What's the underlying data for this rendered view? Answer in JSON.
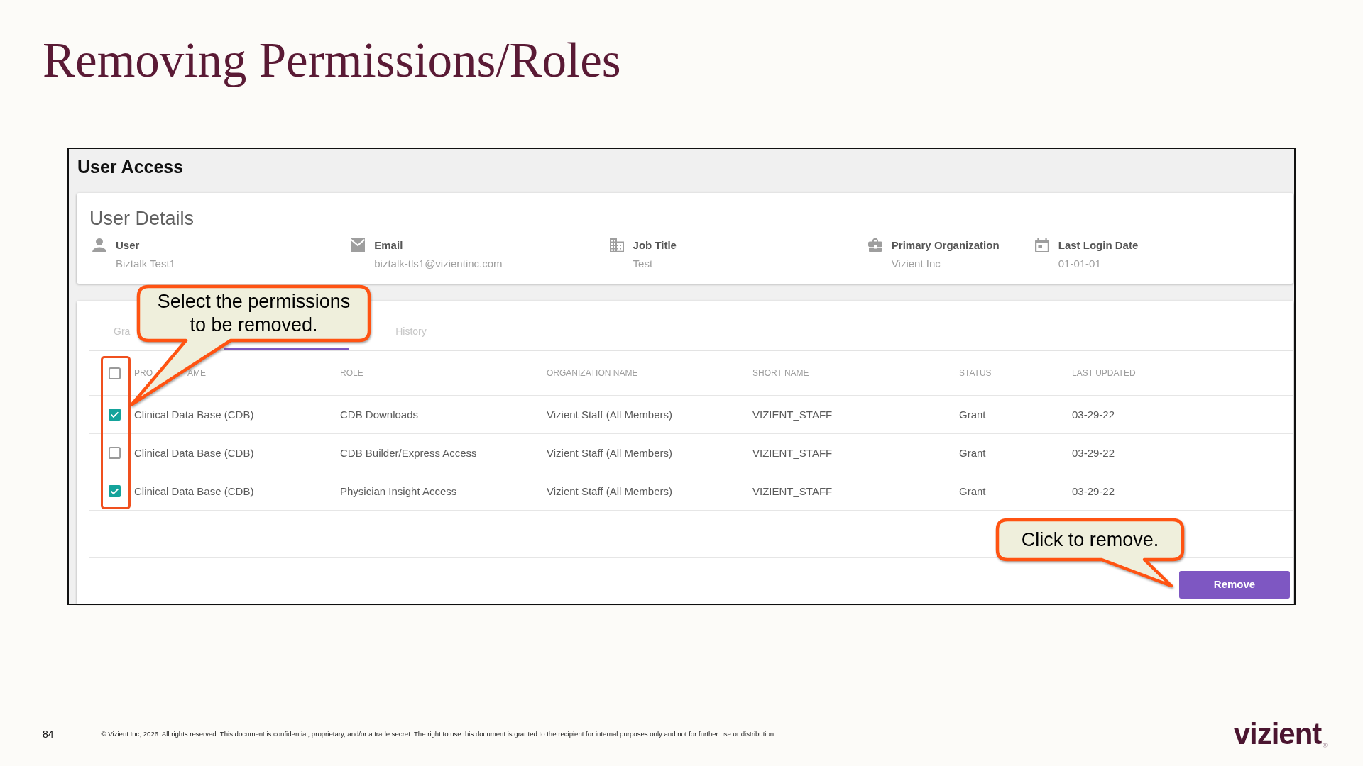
{
  "slide": {
    "title": "Removing Permissions/Roles"
  },
  "app": {
    "title": "User Access",
    "user_details": {
      "title": "User Details",
      "fields": [
        {
          "kind": "user",
          "label": "User",
          "value": "Biztalk Test1"
        },
        {
          "kind": "email",
          "label": "Email",
          "value": "biztalk-tls1@vizientinc.com"
        },
        {
          "kind": "job",
          "label": "Job Title",
          "value": "Test"
        },
        {
          "kind": "organization",
          "label": "Primary Organization",
          "value": "Vizient Inc"
        },
        {
          "kind": "date",
          "label": "Last Login Date",
          "value": "01-01-01"
        }
      ]
    },
    "tabs": [
      {
        "label": "Gra",
        "selected": false
      },
      {
        "selected": true
      },
      {
        "label": "History",
        "selected": false
      }
    ],
    "table": {
      "select_all": {
        "checked": false
      },
      "columns": [
        {
          "label_parts": [
            "PRO",
            "AME"
          ]
        },
        {
          "label": "ROLE"
        },
        {
          "label": "ORGANIZATION NAME"
        },
        {
          "label": "SHORT NAME"
        },
        {
          "label": "STATUS"
        },
        {
          "label": "LAST UPDATED"
        }
      ],
      "rows": [
        {
          "checked": true,
          "cells": [
            "Clinical Data Base (CDB)",
            "CDB Downloads",
            "Vizient Staff (All Members)",
            "VIZIENT_STAFF",
            "Grant",
            "03-29-22"
          ]
        },
        {
          "checked": false,
          "cells": [
            "Clinical Data Base (CDB)",
            "CDB Builder/Express Access",
            "Vizient Staff (All Members)",
            "VIZIENT_STAFF",
            "Grant",
            "03-29-22"
          ]
        },
        {
          "checked": true,
          "cells": [
            "Clinical Data Base (CDB)",
            "Physician Insight Access",
            "Vizient Staff (All Members)",
            "VIZIENT_STAFF",
            "Grant",
            "03-29-22"
          ]
        }
      ]
    },
    "remove_button": {
      "label": "Remove"
    }
  },
  "callouts": [
    {
      "kind": "checkbox_column",
      "text": "Select the permissions\nto be removed."
    },
    {
      "kind": "remove_button",
      "text": "Click to remove."
    }
  ],
  "footer": {
    "page_number": "84",
    "copyright": "© Vizient Inc, 2026. All rights reserved. This document is confidential, proprietary, and/or a trade secret. The right to use this document is granted to the recipient for internal purposes only and not for further use or distribution.",
    "logo": {
      "wordmark": "vizient",
      "mark": "®"
    }
  }
}
